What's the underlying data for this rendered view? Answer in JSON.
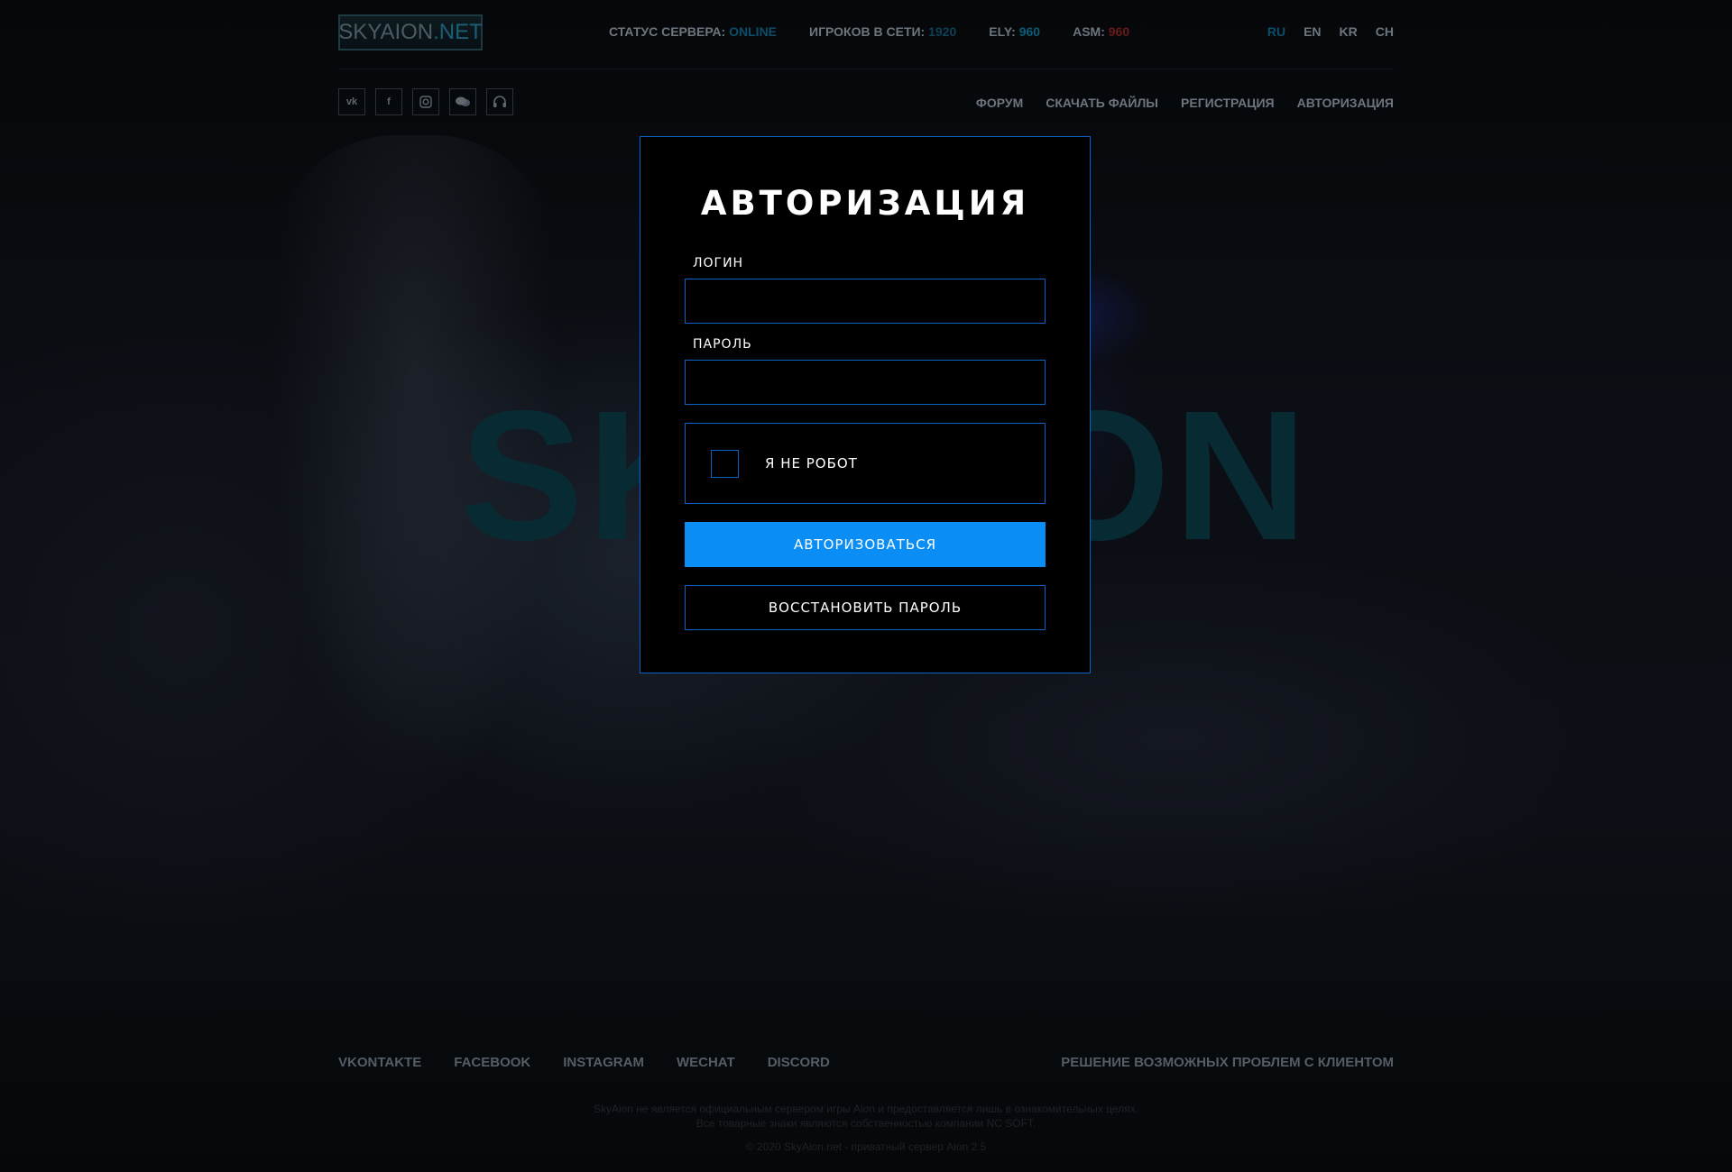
{
  "header": {
    "logo": {
      "main": "SKYAION",
      "domain": ".NET"
    },
    "stats": {
      "server_status_label": "СТАТУС СЕРВЕРА:",
      "server_status_value": "ONLINE",
      "players_label": "ИГРОКОВ В СЕТИ:",
      "players_value": "1920",
      "ely_label": "ELY:",
      "ely_value": "960",
      "asm_label": "ASM:",
      "asm_value": "960"
    },
    "languages": [
      "RU",
      "EN",
      "KR",
      "CH"
    ],
    "active_language": "RU"
  },
  "socials": [
    {
      "label": "vk",
      "icon": "vk-icon"
    },
    {
      "label": "f",
      "icon": "facebook-icon"
    },
    {
      "label": "",
      "icon": "instagram-icon"
    },
    {
      "label": "",
      "icon": "chat-icon"
    },
    {
      "label": "",
      "icon": "headset-icon"
    }
  ],
  "nav": [
    "ФОРУМ",
    "СКАЧАТЬ ФАЙЛЫ",
    "РЕГИСТРАЦИЯ",
    "АВТОРИЗАЦИЯ"
  ],
  "background": {
    "watermark": "SKYAION"
  },
  "modal": {
    "title": "АВТОРИЗАЦИЯ",
    "login_label": "ЛОГИН",
    "login_value": "",
    "password_label": "ПАРОЛЬ",
    "password_value": "",
    "captcha_label": "Я НЕ РОБОТ",
    "submit_label": "АВТОРИЗОВАТЬСЯ",
    "restore_label": "ВОССТАНОВИТЬ ПАРОЛЬ"
  },
  "footer": {
    "links": [
      "VKONTAKTE",
      "FACEBOOK",
      "INSTAGRAM",
      "WECHAT",
      "DISCORD"
    ],
    "help": "РЕШЕНИЕ ВОЗМОЖНЫХ ПРОБЛЕМ С КЛИЕНТОМ",
    "disclaimer_line1": "SkyAion не является официальным сервером игры Aion и предоставляется лишь в ознакомительных целях.",
    "disclaimer_line2": "Все товарные знаки являются собственностью компании NC SOFT.",
    "copyright": "© 2020 SkyAion.net - приватный сервер Aion 2.5"
  },
  "colors": {
    "accent": "#0a8df5",
    "border": "#0b62c4",
    "online": "#0c4e6a",
    "asm": "#6a1a1a"
  }
}
